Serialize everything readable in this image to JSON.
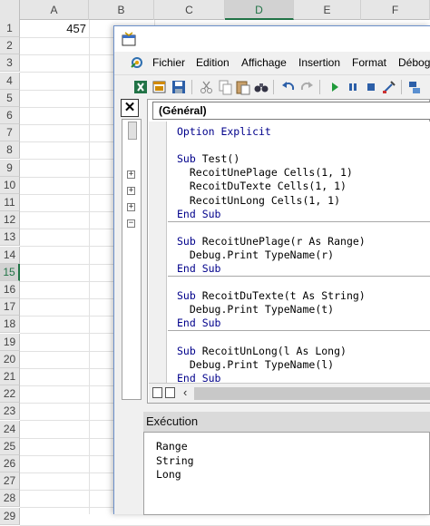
{
  "sheet": {
    "columns": [
      "A",
      "B",
      "C",
      "D",
      "E",
      "F"
    ],
    "selected_column": "D",
    "rows": [
      "1",
      "2",
      "3",
      "4",
      "5",
      "6",
      "7",
      "8",
      "9",
      "10",
      "11",
      "12",
      "13",
      "14",
      "15",
      "16",
      "17",
      "18",
      "19",
      "20",
      "21",
      "22",
      "23",
      "24",
      "25",
      "26",
      "27",
      "28",
      "29"
    ],
    "selected_row": "15",
    "cell_A1": "457"
  },
  "vbe": {
    "menu": [
      "Fichier",
      "Edition",
      "Affichage",
      "Insertion",
      "Format",
      "Débog"
    ],
    "toolbar_icons": [
      "excel-icon",
      "insert-module-icon",
      "save-icon",
      "cut-icon",
      "copy-icon",
      "paste-icon",
      "find-icon",
      "undo-icon",
      "redo-icon",
      "run-icon",
      "pause-icon",
      "stop-icon",
      "design-mode-icon",
      "project-explorer-icon"
    ],
    "close_glyph": "✕",
    "procedure_combo": "(Général)",
    "code_lines": [
      {
        "kw": "Option Explicit",
        "tx": ""
      },
      {
        "kw": "",
        "tx": ""
      },
      {
        "kw": "Sub ",
        "tx": "Test()"
      },
      {
        "kw": "",
        "tx": "  RecoitUnePlage Cells(1, 1)"
      },
      {
        "kw": "",
        "tx": "  RecoitDuTexte Cells(1, 1)"
      },
      {
        "kw": "",
        "tx": "  RecoitUnLong Cells(1, 1)"
      },
      {
        "kw": "End Sub",
        "tx": ""
      },
      {
        "kw": "",
        "tx": ""
      },
      {
        "kw": "Sub ",
        "tx": "RecoitUnePlage(r As Range)"
      },
      {
        "kw": "",
        "tx": "  Debug.Print TypeName(r)"
      },
      {
        "kw": "End Sub",
        "tx": ""
      },
      {
        "kw": "",
        "tx": ""
      },
      {
        "kw": "Sub ",
        "tx": "RecoitDuTexte(t As String)"
      },
      {
        "kw": "",
        "tx": "  Debug.Print TypeName(t)"
      },
      {
        "kw": "End Sub",
        "tx": ""
      },
      {
        "kw": "",
        "tx": ""
      },
      {
        "kw": "Sub ",
        "tx": "RecoitUnLong(l As Long)"
      },
      {
        "kw": "",
        "tx": "  Debug.Print TypeName(l)"
      },
      {
        "kw": "End Sub",
        "tx": ""
      }
    ],
    "immediate_title": "Exécution",
    "immediate_lines": [
      "Range",
      "String",
      "Long"
    ]
  }
}
